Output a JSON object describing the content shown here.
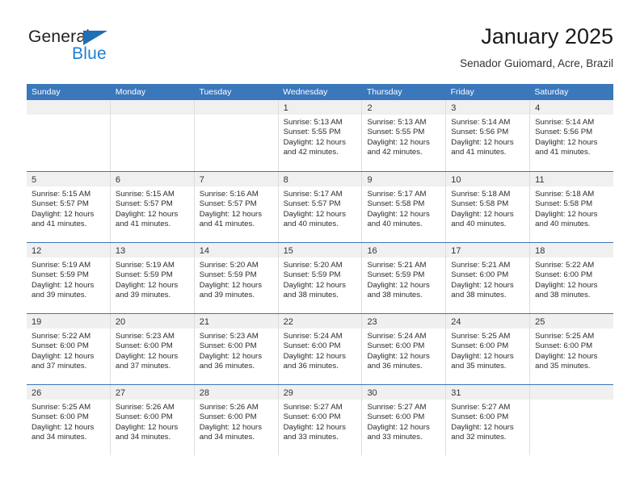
{
  "brand": {
    "word_one": "General",
    "word_two": "Blue",
    "triangle_icon": "triangle-icon",
    "accent_color": "#1f7fd4"
  },
  "header": {
    "title": "January 2025",
    "subtitle": "Senador Guiomard, Acre, Brazil"
  },
  "theme": {
    "header_blue": "#3a77bb",
    "row_band_gray": "#f0f0f0",
    "text_color": "#2b2b2b"
  },
  "calendar": {
    "weekdays": [
      "Sunday",
      "Monday",
      "Tuesday",
      "Wednesday",
      "Thursday",
      "Friday",
      "Saturday"
    ],
    "weeks": [
      [
        {
          "day": "",
          "sunrise": "",
          "sunset": "",
          "daylight_line1": "",
          "daylight_line2": ""
        },
        {
          "day": "",
          "sunrise": "",
          "sunset": "",
          "daylight_line1": "",
          "daylight_line2": ""
        },
        {
          "day": "",
          "sunrise": "",
          "sunset": "",
          "daylight_line1": "",
          "daylight_line2": ""
        },
        {
          "day": "1",
          "sunrise": "Sunrise: 5:13 AM",
          "sunset": "Sunset: 5:55 PM",
          "daylight_line1": "Daylight: 12 hours",
          "daylight_line2": "and 42 minutes."
        },
        {
          "day": "2",
          "sunrise": "Sunrise: 5:13 AM",
          "sunset": "Sunset: 5:55 PM",
          "daylight_line1": "Daylight: 12 hours",
          "daylight_line2": "and 42 minutes."
        },
        {
          "day": "3",
          "sunrise": "Sunrise: 5:14 AM",
          "sunset": "Sunset: 5:56 PM",
          "daylight_line1": "Daylight: 12 hours",
          "daylight_line2": "and 41 minutes."
        },
        {
          "day": "4",
          "sunrise": "Sunrise: 5:14 AM",
          "sunset": "Sunset: 5:56 PM",
          "daylight_line1": "Daylight: 12 hours",
          "daylight_line2": "and 41 minutes."
        }
      ],
      [
        {
          "day": "5",
          "sunrise": "Sunrise: 5:15 AM",
          "sunset": "Sunset: 5:57 PM",
          "daylight_line1": "Daylight: 12 hours",
          "daylight_line2": "and 41 minutes."
        },
        {
          "day": "6",
          "sunrise": "Sunrise: 5:15 AM",
          "sunset": "Sunset: 5:57 PM",
          "daylight_line1": "Daylight: 12 hours",
          "daylight_line2": "and 41 minutes."
        },
        {
          "day": "7",
          "sunrise": "Sunrise: 5:16 AM",
          "sunset": "Sunset: 5:57 PM",
          "daylight_line1": "Daylight: 12 hours",
          "daylight_line2": "and 41 minutes."
        },
        {
          "day": "8",
          "sunrise": "Sunrise: 5:17 AM",
          "sunset": "Sunset: 5:57 PM",
          "daylight_line1": "Daylight: 12 hours",
          "daylight_line2": "and 40 minutes."
        },
        {
          "day": "9",
          "sunrise": "Sunrise: 5:17 AM",
          "sunset": "Sunset: 5:58 PM",
          "daylight_line1": "Daylight: 12 hours",
          "daylight_line2": "and 40 minutes."
        },
        {
          "day": "10",
          "sunrise": "Sunrise: 5:18 AM",
          "sunset": "Sunset: 5:58 PM",
          "daylight_line1": "Daylight: 12 hours",
          "daylight_line2": "and 40 minutes."
        },
        {
          "day": "11",
          "sunrise": "Sunrise: 5:18 AM",
          "sunset": "Sunset: 5:58 PM",
          "daylight_line1": "Daylight: 12 hours",
          "daylight_line2": "and 40 minutes."
        }
      ],
      [
        {
          "day": "12",
          "sunrise": "Sunrise: 5:19 AM",
          "sunset": "Sunset: 5:59 PM",
          "daylight_line1": "Daylight: 12 hours",
          "daylight_line2": "and 39 minutes."
        },
        {
          "day": "13",
          "sunrise": "Sunrise: 5:19 AM",
          "sunset": "Sunset: 5:59 PM",
          "daylight_line1": "Daylight: 12 hours",
          "daylight_line2": "and 39 minutes."
        },
        {
          "day": "14",
          "sunrise": "Sunrise: 5:20 AM",
          "sunset": "Sunset: 5:59 PM",
          "daylight_line1": "Daylight: 12 hours",
          "daylight_line2": "and 39 minutes."
        },
        {
          "day": "15",
          "sunrise": "Sunrise: 5:20 AM",
          "sunset": "Sunset: 5:59 PM",
          "daylight_line1": "Daylight: 12 hours",
          "daylight_line2": "and 38 minutes."
        },
        {
          "day": "16",
          "sunrise": "Sunrise: 5:21 AM",
          "sunset": "Sunset: 5:59 PM",
          "daylight_line1": "Daylight: 12 hours",
          "daylight_line2": "and 38 minutes."
        },
        {
          "day": "17",
          "sunrise": "Sunrise: 5:21 AM",
          "sunset": "Sunset: 6:00 PM",
          "daylight_line1": "Daylight: 12 hours",
          "daylight_line2": "and 38 minutes."
        },
        {
          "day": "18",
          "sunrise": "Sunrise: 5:22 AM",
          "sunset": "Sunset: 6:00 PM",
          "daylight_line1": "Daylight: 12 hours",
          "daylight_line2": "and 38 minutes."
        }
      ],
      [
        {
          "day": "19",
          "sunrise": "Sunrise: 5:22 AM",
          "sunset": "Sunset: 6:00 PM",
          "daylight_line1": "Daylight: 12 hours",
          "daylight_line2": "and 37 minutes."
        },
        {
          "day": "20",
          "sunrise": "Sunrise: 5:23 AM",
          "sunset": "Sunset: 6:00 PM",
          "daylight_line1": "Daylight: 12 hours",
          "daylight_line2": "and 37 minutes."
        },
        {
          "day": "21",
          "sunrise": "Sunrise: 5:23 AM",
          "sunset": "Sunset: 6:00 PM",
          "daylight_line1": "Daylight: 12 hours",
          "daylight_line2": "and 36 minutes."
        },
        {
          "day": "22",
          "sunrise": "Sunrise: 5:24 AM",
          "sunset": "Sunset: 6:00 PM",
          "daylight_line1": "Daylight: 12 hours",
          "daylight_line2": "and 36 minutes."
        },
        {
          "day": "23",
          "sunrise": "Sunrise: 5:24 AM",
          "sunset": "Sunset: 6:00 PM",
          "daylight_line1": "Daylight: 12 hours",
          "daylight_line2": "and 36 minutes."
        },
        {
          "day": "24",
          "sunrise": "Sunrise: 5:25 AM",
          "sunset": "Sunset: 6:00 PM",
          "daylight_line1": "Daylight: 12 hours",
          "daylight_line2": "and 35 minutes."
        },
        {
          "day": "25",
          "sunrise": "Sunrise: 5:25 AM",
          "sunset": "Sunset: 6:00 PM",
          "daylight_line1": "Daylight: 12 hours",
          "daylight_line2": "and 35 minutes."
        }
      ],
      [
        {
          "day": "26",
          "sunrise": "Sunrise: 5:25 AM",
          "sunset": "Sunset: 6:00 PM",
          "daylight_line1": "Daylight: 12 hours",
          "daylight_line2": "and 34 minutes."
        },
        {
          "day": "27",
          "sunrise": "Sunrise: 5:26 AM",
          "sunset": "Sunset: 6:00 PM",
          "daylight_line1": "Daylight: 12 hours",
          "daylight_line2": "and 34 minutes."
        },
        {
          "day": "28",
          "sunrise": "Sunrise: 5:26 AM",
          "sunset": "Sunset: 6:00 PM",
          "daylight_line1": "Daylight: 12 hours",
          "daylight_line2": "and 34 minutes."
        },
        {
          "day": "29",
          "sunrise": "Sunrise: 5:27 AM",
          "sunset": "Sunset: 6:00 PM",
          "daylight_line1": "Daylight: 12 hours",
          "daylight_line2": "and 33 minutes."
        },
        {
          "day": "30",
          "sunrise": "Sunrise: 5:27 AM",
          "sunset": "Sunset: 6:00 PM",
          "daylight_line1": "Daylight: 12 hours",
          "daylight_line2": "and 33 minutes."
        },
        {
          "day": "31",
          "sunrise": "Sunrise: 5:27 AM",
          "sunset": "Sunset: 6:00 PM",
          "daylight_line1": "Daylight: 12 hours",
          "daylight_line2": "and 32 minutes."
        },
        {
          "day": "",
          "sunrise": "",
          "sunset": "",
          "daylight_line1": "",
          "daylight_line2": ""
        }
      ]
    ]
  }
}
